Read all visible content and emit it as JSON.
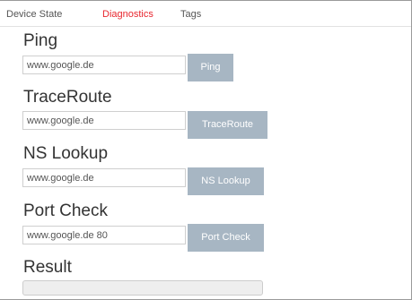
{
  "tabs": [
    {
      "label": "Device State",
      "active": false
    },
    {
      "label": "Diagnostics",
      "active": true
    },
    {
      "label": "Tags",
      "active": false
    }
  ],
  "sections": {
    "ping": {
      "title": "Ping",
      "input_value": "www.google.de",
      "button_label": "Ping"
    },
    "traceroute": {
      "title": "TraceRoute",
      "input_value": "www.google.de",
      "button_label": "TraceRoute"
    },
    "nslookup": {
      "title": "NS Lookup",
      "input_value": "www.google.de",
      "button_label": "NS Lookup"
    },
    "portcheck": {
      "title": "Port Check",
      "input_value": "www.google.de 80",
      "button_label": "Port Check"
    }
  },
  "result": {
    "title": "Result",
    "value": ""
  },
  "colors": {
    "active_tab": "#e8262e",
    "button_bg": "#a7b6c3",
    "button_text": "#ffffff"
  }
}
